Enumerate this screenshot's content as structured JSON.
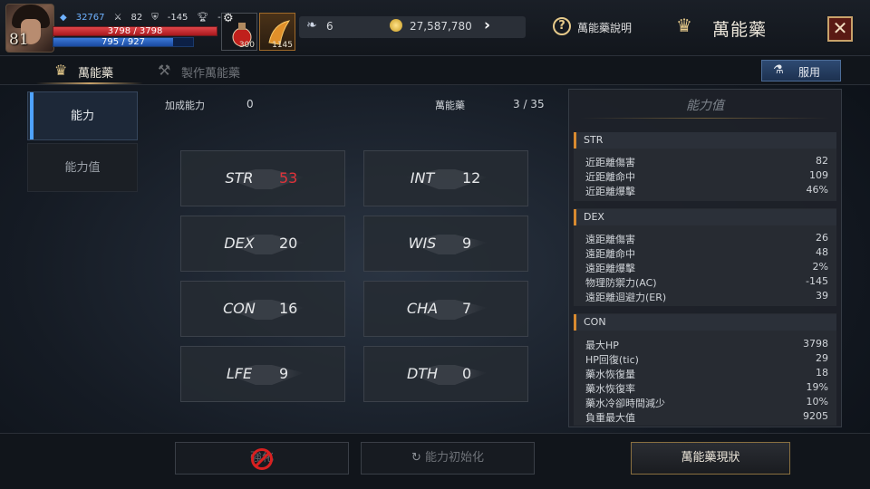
{
  "player": {
    "level": "81",
    "power": "32767",
    "atk": "82",
    "def": "-145",
    "rank": "-",
    "hp_text": "3798 / 3798",
    "mp_text": "795 / 927",
    "hp_fraction": 1.0,
    "mp_fraction": 0.858
  },
  "slots": [
    {
      "count": "300"
    },
    {
      "count": "1145"
    }
  ],
  "resources": {
    "feather": "6",
    "gold": "27,587,780"
  },
  "header": {
    "help_label": "萬能藥說明",
    "title": "萬能藥",
    "close_glyph": "✕"
  },
  "tabs": [
    {
      "label": "萬能藥"
    },
    {
      "label": "製作萬能藥"
    }
  ],
  "use_button": "服用",
  "nav": [
    {
      "label": "能力"
    },
    {
      "label": "能力值"
    }
  ],
  "center": {
    "bonus_label": "加成能力",
    "bonus_value": "0",
    "elixir_label": "萬能藥",
    "elixir_value": "3 / 35"
  },
  "stats": [
    {
      "name": "STR",
      "value": "53",
      "highlight": true
    },
    {
      "name": "INT",
      "value": "12"
    },
    {
      "name": "DEX",
      "value": "20"
    },
    {
      "name": "WIS",
      "value": "9"
    },
    {
      "name": "CON",
      "value": "16"
    },
    {
      "name": "CHA",
      "value": "7"
    },
    {
      "name": "LFE",
      "value": "9"
    },
    {
      "name": "DTH",
      "value": "0"
    }
  ],
  "right_panel": {
    "title": "能力值",
    "sections": [
      {
        "header": "STR",
        "rows": [
          {
            "k": "近距離傷害",
            "v": "82"
          },
          {
            "k": "近距離命中",
            "v": "109"
          },
          {
            "k": "近距離爆擊",
            "v": "46%"
          }
        ]
      },
      {
        "header": "DEX",
        "rows": [
          {
            "k": "遠距離傷害",
            "v": "26"
          },
          {
            "k": "遠距離命中",
            "v": "48"
          },
          {
            "k": "遠距離爆擊",
            "v": "2%"
          },
          {
            "k": "物理防禦力(AC)",
            "v": "-145"
          },
          {
            "k": "遠距離迴避力(ER)",
            "v": "39"
          }
        ]
      },
      {
        "header": "CON",
        "rows": [
          {
            "k": "最大HP",
            "v": "3798"
          },
          {
            "k": "HP回復(tic)",
            "v": "29"
          },
          {
            "k": "藥水恢復量",
            "v": "18"
          },
          {
            "k": "藥水恢復率",
            "v": "19%"
          },
          {
            "k": "藥水冷卻時間減少",
            "v": "10%"
          },
          {
            "k": "負重最大值",
            "v": "9205"
          }
        ]
      }
    ]
  },
  "bottom": {
    "btn1": "強化",
    "btn2": "能力初始化",
    "btn3": "萬能藥現狀"
  },
  "colors": {
    "accent_gold": "#c8a26a",
    "nav_active": "#4ea2ff",
    "stat_highlight": "#e0333a",
    "section_marker": "#d88a30"
  }
}
